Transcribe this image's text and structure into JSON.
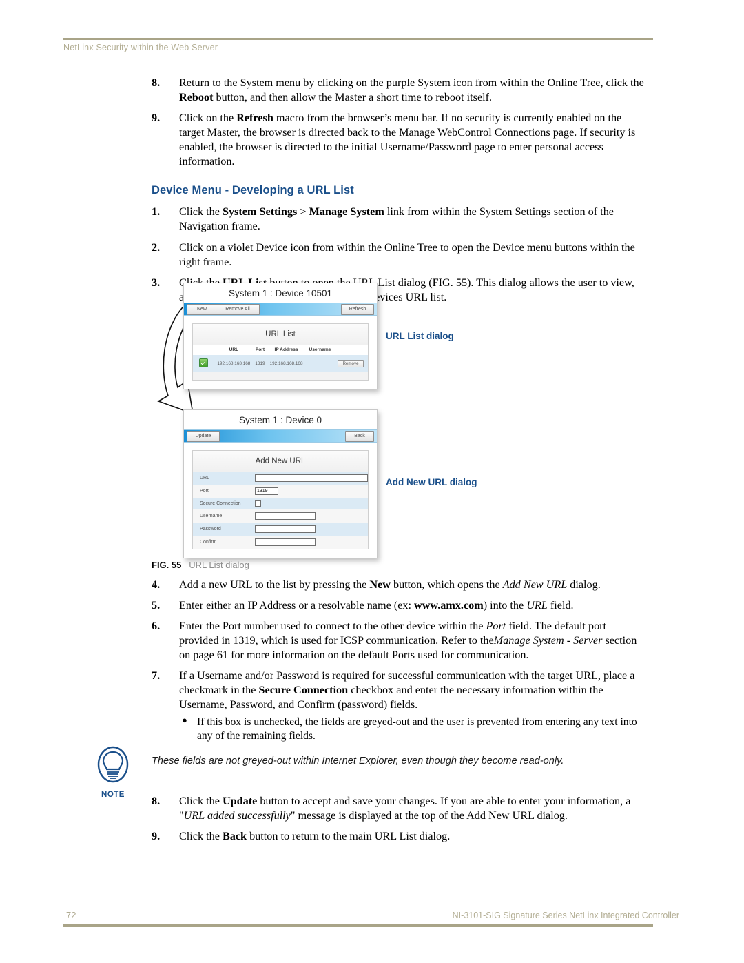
{
  "header": {
    "running_head": "NetLinx Security within the Web Server"
  },
  "footer": {
    "page_number": "72",
    "doc_title": "NI-3101-SIG Signature Series NetLinx Integrated Controller"
  },
  "colors": {
    "accent_blue": "#1a4f8a",
    "rule_khaki": "#a9a488",
    "toolbar_blue": "#1a8fd6",
    "row_blue": "#dbeaf5",
    "check_green": "#3f9b28"
  },
  "steps_before": [
    {
      "num": "8.",
      "html": "Return to the System menu by clicking on the purple System icon from within the Online Tree, click the <b>Reboot</b> button, and then allow the Master a short time to reboot itself."
    },
    {
      "num": "9.",
      "html": "Click on the <b>Refresh</b> macro from the browser’s menu bar. If no security is currently enabled on the target Master, the browser is directed back to the Manage WebControl Connections page. If security is enabled, the browser is directed to the initial Username/Password page to enter personal access information."
    }
  ],
  "section": {
    "heading": "Device Menu - Developing a URL List"
  },
  "steps_main": [
    {
      "num": "1.",
      "html": "Click the <b>System Settings</b> &gt; <b>Manage System</b> link from within the System Settings section of the Navigation frame."
    },
    {
      "num": "2.",
      "html": "Click on a violet Device icon from within the Online Tree to open the Device menu buttons within the right frame."
    },
    {
      "num": "3.",
      "html": "Click the <b>URL List</b> button to open the URL List dialog (FIG. 55). This dialog allows the user to view, add, and remove URLs from the specified devices URL list."
    }
  ],
  "figure": {
    "caption_label": "FIG. 55",
    "caption_text": "URL List dialog",
    "label_url_list": "URL List dialog",
    "label_add_new": "Add New URL dialog",
    "url_list_dialog": {
      "title": "System 1 : Device 10501",
      "buttons": {
        "new": "New",
        "remove_all": "Remove All",
        "refresh": "Refresh"
      },
      "panel_heading": "URL List",
      "columns": [
        "URL",
        "Port",
        "IP Address",
        "Username"
      ],
      "rows": [
        {
          "enabled": true,
          "url": "192.168.168.168",
          "port": "1319",
          "ip_address": "192.168.168.168",
          "username": "",
          "remove_label": "Remove"
        }
      ]
    },
    "add_new_url_dialog": {
      "title": "System 1 : Device 0",
      "buttons": {
        "update": "Update",
        "back": "Back"
      },
      "panel_heading": "Add New URL",
      "fields": [
        {
          "label": "URL",
          "value": "",
          "type": "text"
        },
        {
          "label": "Port",
          "value": "1319",
          "type": "text"
        },
        {
          "label": "Secure Connection",
          "value": "",
          "type": "checkbox",
          "checked": false
        },
        {
          "label": "Username",
          "value": "",
          "type": "text"
        },
        {
          "label": "Password",
          "value": "",
          "type": "text"
        },
        {
          "label": "Confirm",
          "value": "",
          "type": "text"
        }
      ]
    }
  },
  "steps_after_fig": [
    {
      "num": "4.",
      "html": "Add a new URL to the list by pressing the <b>New</b> button, which opens the <i>Add New URL</i> dialog."
    },
    {
      "num": "5.",
      "html": "Enter either an IP Address or a resolvable name (ex: <b>www.amx.com</b>) into the <i>URL</i> field."
    },
    {
      "num": "6.",
      "html": "Enter the Port number used to connect to the other device within the <i>Port</i> field. The default port provided in 1319, which is used for ICSP communication. Refer to the<i>Manage System - Server</i> section on page 61 for more information on the default Ports used for communication."
    },
    {
      "num": "7.",
      "html": "If a Username and/or Password is required for successful communication with the target URL, place a checkmark in the <b>Secure Connection</b> checkbox and enter the necessary information within the Username, Password, and Confirm (password) fields.",
      "subs": [
        "If this box is unchecked, the fields are greyed-out and the user is prevented from entering any text into any of the remaining fields."
      ]
    }
  ],
  "note": {
    "icon": "lightbulb-icon",
    "label": "NOTE",
    "text": "These fields are not greyed-out within Internet Explorer, even though they become read-only."
  },
  "steps_tail": [
    {
      "num": "8.",
      "html": "Click the <b>Update</b> button to accept and save your changes. If you are able to enter your information, a \"<i>URL added successfully</i>\" message is displayed at the top of the Add New URL dialog."
    },
    {
      "num": "9.",
      "html": "Click the <b>Back</b> button to return to the main URL List dialog."
    }
  ]
}
